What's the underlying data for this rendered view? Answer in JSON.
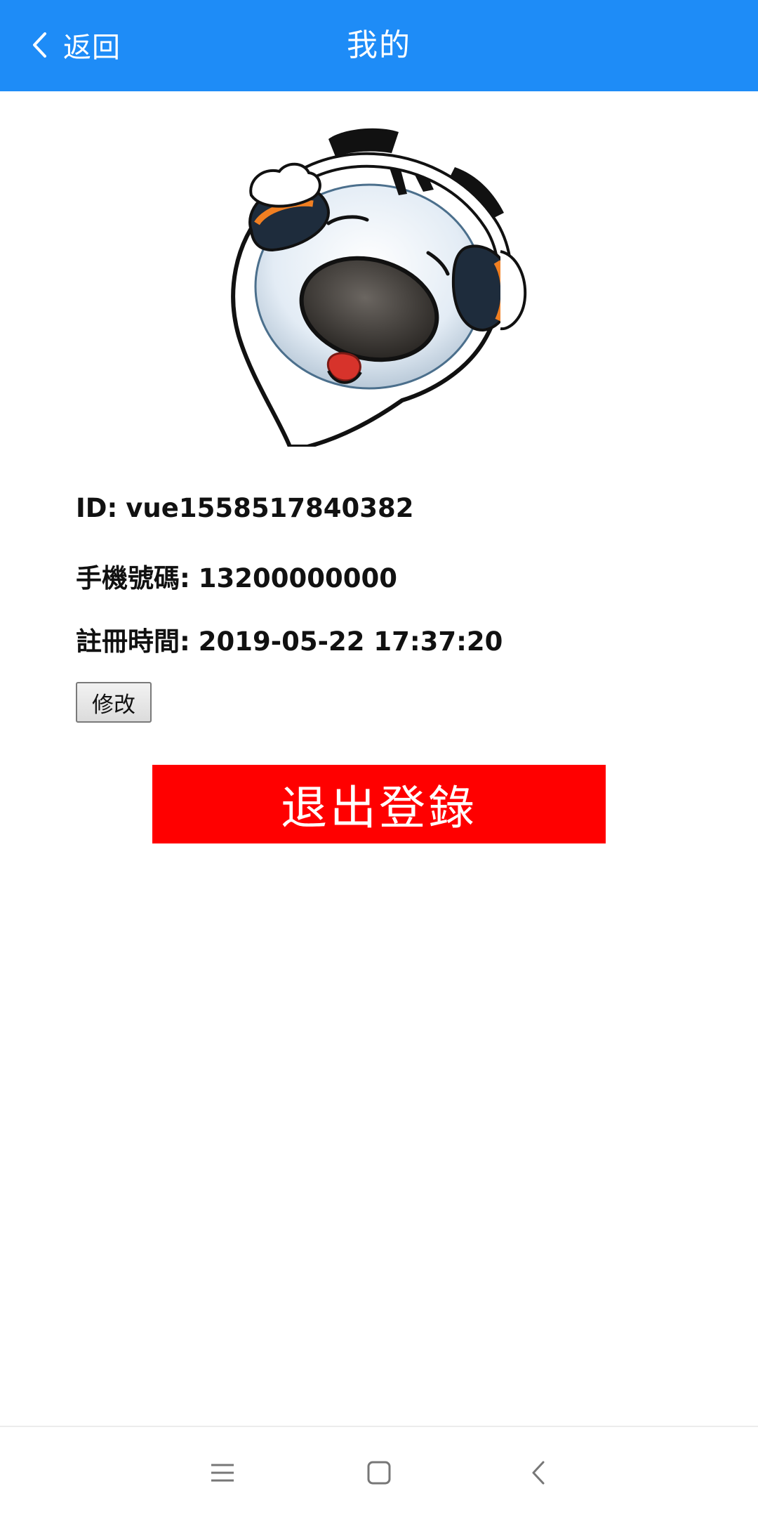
{
  "header": {
    "back_label": "返回",
    "title": "我的",
    "background_color": "#1e8cf7"
  },
  "avatar": {
    "icon": "cartoon-avatar-with-headphones"
  },
  "profile": {
    "id_label": "ID:",
    "id_value": "vue1558517840382",
    "phone_label": "手機號碼:",
    "phone_value": "13200000000",
    "register_label": "註冊時間:",
    "register_value": "2019-05-22 17:37:20"
  },
  "actions": {
    "edit_label": "修改",
    "logout_label": "退出登錄",
    "logout_color": "#ff0000"
  },
  "navbar": {
    "items": [
      "menu-icon",
      "home-icon",
      "back-icon"
    ]
  }
}
